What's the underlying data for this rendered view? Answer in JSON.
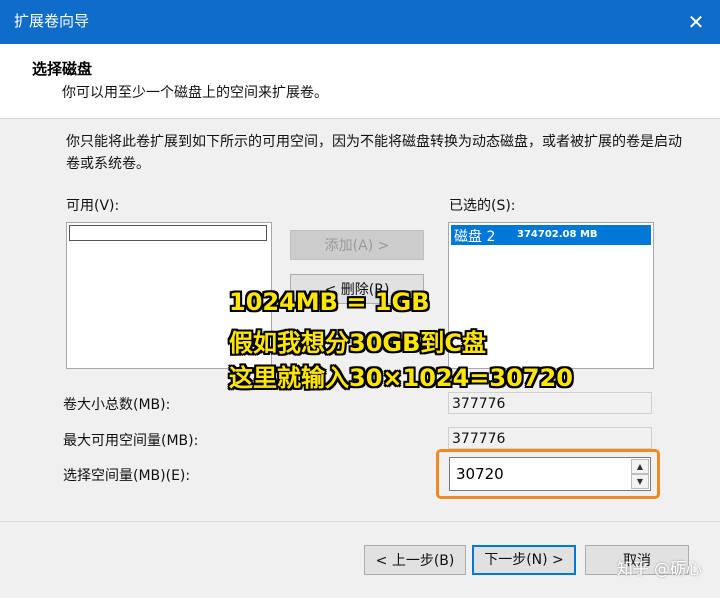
{
  "window": {
    "title": "扩展卷向导",
    "close_icon": "close-icon"
  },
  "header": {
    "title": "选择磁盘",
    "subtitle": "你可以用至少一个磁盘上的空间来扩展卷。"
  },
  "description": "你只能将此卷扩展到如下所示的可用空间，因为不能将磁盘转换为动态磁盘，或者被扩展的卷是启动卷或系统卷。",
  "available": {
    "label": "可用(V):"
  },
  "selected": {
    "label": "已选的(S):",
    "items": [
      {
        "name": "磁盘 2",
        "size": "374702.08 MB"
      }
    ]
  },
  "buttons": {
    "add": "添加(A) >",
    "remove": "< 删除(R)",
    "back": "< 上一步(B)",
    "next": "下一步(N) >",
    "cancel": "取消"
  },
  "fields": {
    "total_label": "卷大小总数(MB):",
    "total_value": "377776",
    "max_label": "最大可用空间量(MB):",
    "max_value": "377776",
    "select_label": "选择空间量(MB)(E):",
    "select_value": "30720"
  },
  "annotation": [
    "1024MB = 1GB",
    "假如我想分30GB到C盘",
    "这里就输入30×1024=30720"
  ],
  "watermark": "知乎 @砺心",
  "colors": {
    "titlebar": "#0f6cc8",
    "selection": "#0078d7",
    "highlight_box": "#f08a1e",
    "annotation_text": "#ffe600"
  }
}
